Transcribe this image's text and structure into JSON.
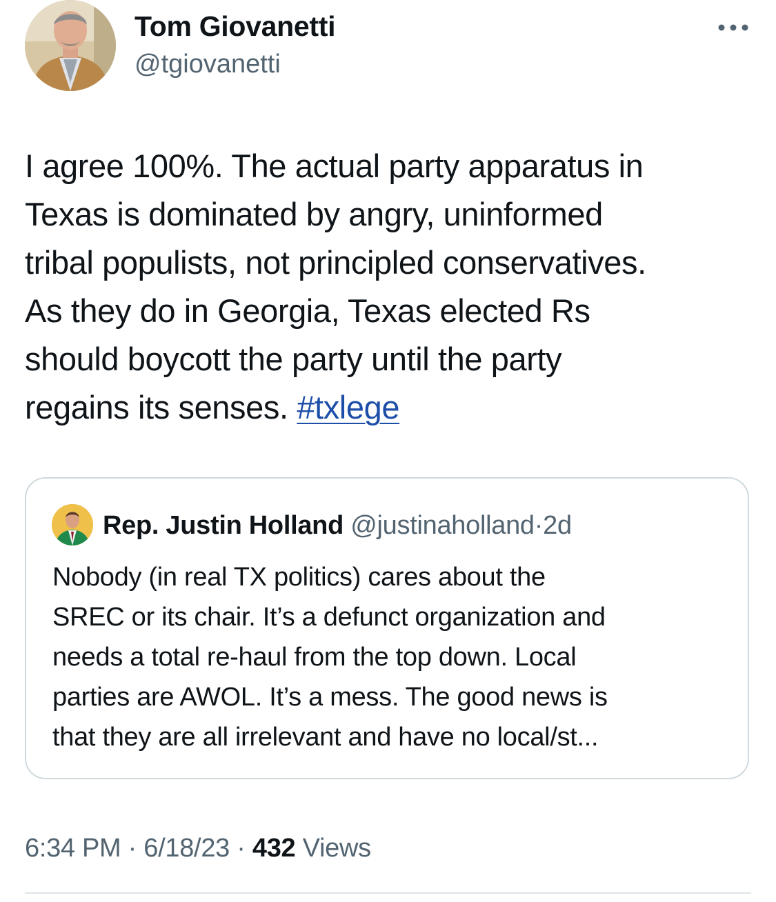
{
  "tweet": {
    "author": {
      "display_name": "Tom Giovanetti",
      "handle": "@tgiovanetti",
      "avatar_icon": "profile-photo"
    },
    "more_icon": "more-dots-icon",
    "text": "I agree 100%. The actual party apparatus in\nTexas is dominated by angry, uninformed\ntribal populists, not principled conservatives.\nAs they do in Georgia, Texas elected Rs\nshould boycott the party until the party\nregains its senses. ",
    "hashtag": "#txlege",
    "quoted": {
      "display_name": "Rep. Justin Holland",
      "handle": "@justinaholland",
      "separator": "·",
      "time": "2d",
      "text": "Nobody (in real TX politics) cares about the\nSREC or its chair. It’s a defunct organization and\nneeds a total re-haul from the top down. Local\nparties are AWOL. It’s a mess. The good news is\nthat they are all irrelevant and have no local/st..."
    },
    "meta": {
      "time": "6:34 PM",
      "separator": " · ",
      "date": "6/18/23",
      "views_count": "432",
      "views_label": "Views"
    }
  },
  "colors": {
    "text": "#0f1419",
    "secondary": "#536471",
    "link": "#1d4ea8",
    "border": "#cfd9de"
  }
}
